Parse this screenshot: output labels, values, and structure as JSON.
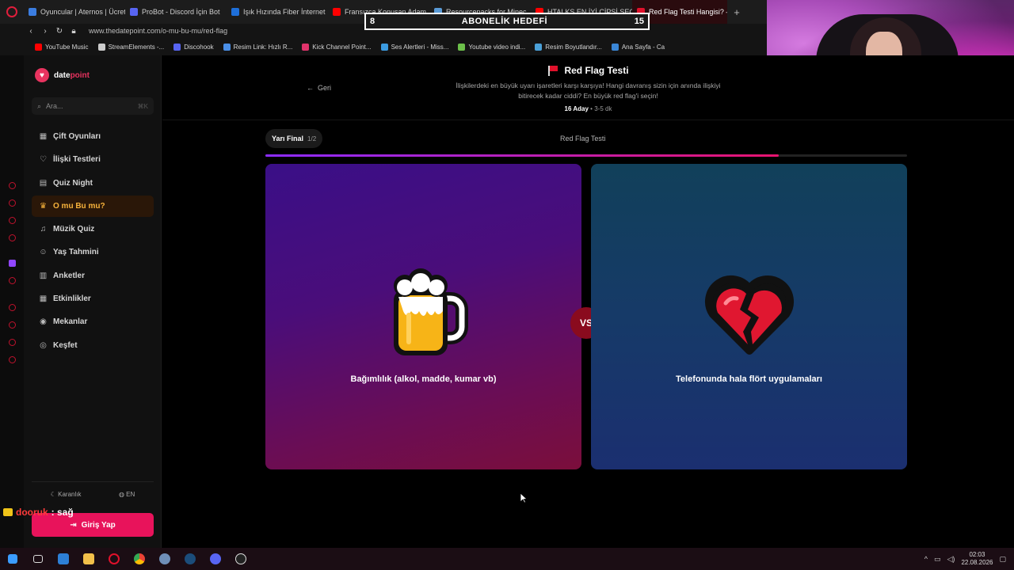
{
  "browser": {
    "tabs": [
      {
        "label": "Oyuncular | Aternos | Ücret",
        "color": "#3b7de0",
        "active": false
      },
      {
        "label": "ProBot - Discord İçin Bot",
        "color": "#5865f2",
        "active": false
      },
      {
        "label": "Işık Hızında Fiber İnternet",
        "color": "#1e6fd9",
        "active": false
      },
      {
        "label": "Fransızca Konuşan Adam",
        "color": "#ff0000",
        "active": false
      },
      {
        "label": "Resourcepacks for Minec",
        "color": "#5a9ad6",
        "active": false
      },
      {
        "label": "HTALKS EN İYİ ÇİPSİ SEÇ",
        "color": "#ff0000",
        "active": false
      },
      {
        "label": "Red Flag Testi Hangisi? —",
        "color": "#e0112b",
        "active": true
      }
    ],
    "new_tab": "+",
    "url": "www.thedatepoint.com/o-mu-bu-mu/red-flag",
    "bookmarks": [
      {
        "label": "YouTube Music",
        "color": "#ff0000"
      },
      {
        "label": "StreamElements -...",
        "color": "#cccccc"
      },
      {
        "label": "Discohook",
        "color": "#5865f2"
      },
      {
        "label": "Resim Link: Hızlı R...",
        "color": "#4a8fe8"
      },
      {
        "label": "Kick Channel Point...",
        "color": "#e0336b"
      },
      {
        "label": "Ses Alertleri - Miss...",
        "color": "#3b9be0"
      },
      {
        "label": "Youtube video indi...",
        "color": "#6cc04a"
      },
      {
        "label": "Resim Boyutlandır...",
        "color": "#4aa0d8"
      },
      {
        "label": "Ana Sayfa - Ca",
        "color": "#3a86d6"
      }
    ]
  },
  "goal": {
    "start": "8",
    "title": "ABONELİK HEDEFİ",
    "end": "15",
    "progress": 0.0
  },
  "site": {
    "logo_prefix": "date",
    "logo_suffix": "point",
    "search_placeholder": "Ara...",
    "search_shortcut": "⌘K",
    "menu": [
      {
        "label": "Çift Oyunları",
        "icon": "▦",
        "active": false
      },
      {
        "label": "İlişki Testleri",
        "icon": "♡",
        "active": false
      },
      {
        "label": "Quiz Night",
        "icon": "▤",
        "active": false
      },
      {
        "label": "O mu Bu mu?",
        "icon": "♛",
        "active": true
      },
      {
        "label": "Müzik Quiz",
        "icon": "♫",
        "active": false
      },
      {
        "label": "Yaş Tahmini",
        "icon": "☺",
        "active": false
      },
      {
        "label": "Anketler",
        "icon": "▥",
        "active": false
      },
      {
        "label": "Etkinlikler",
        "icon": "▦",
        "active": false
      },
      {
        "label": "Mekanlar",
        "icon": "◉",
        "active": false
      },
      {
        "label": "Keşfet",
        "icon": "◎",
        "active": false
      }
    ],
    "theme_label": "Karanlık",
    "lang_label": "EN",
    "login_label": "Giriş Yap"
  },
  "game": {
    "back_label": "Geri",
    "title": "Red Flag Testi",
    "description": "İlişkilerdeki en büyük uyarı işaretleri karşı karşıya! Hangi davranış sizin için anında ilişkiyi bitirecek kadar ciddi? En büyük red flag'i seçin!",
    "candidates": "16 Aday",
    "duration": "3-5 dk",
    "round_label": "Yarı Final",
    "round_count": "1/2",
    "round_title": "Red Flag Testi",
    "progress": 0.8,
    "vs_label": "VS",
    "left_option": {
      "label": "Bağımlılık (alkol, madde, kumar vb)",
      "icon": "beer-mug-icon"
    },
    "right_option": {
      "label": "Telefonunda hala flört uygulamaları",
      "icon": "broken-heart-icon"
    }
  },
  "chat": {
    "user": "dooruk",
    "message": ": sağ"
  },
  "taskbar": {
    "time": "02:03",
    "date": "22.08.2026"
  }
}
